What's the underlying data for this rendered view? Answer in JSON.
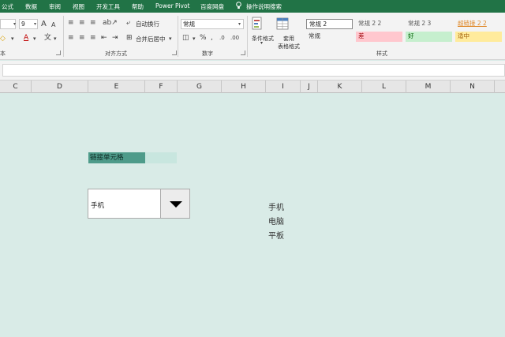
{
  "menu": {
    "items": [
      "公式",
      "数据",
      "审阅",
      "视图",
      "开发工具",
      "帮助",
      "Power Pivot",
      "百度网盘",
      "操作说明搜索"
    ]
  },
  "ribbon": {
    "font": {
      "size": "9",
      "grow_icon": "A",
      "shrink_icon": "A",
      "label": "本"
    },
    "alignment": {
      "wrap_text": "自动换行",
      "merge_center": "合并后居中",
      "label": "对齐方式"
    },
    "number": {
      "format": "常规",
      "label": "数字"
    },
    "styles": {
      "conditional_format": "条件格式",
      "table_format_line1": "套用",
      "table_format_line2": "表格格式",
      "label": "样式",
      "gallery": [
        [
          "常规 2",
          "常规 2 2",
          "常规 2 3",
          "超链接 2 2"
        ],
        [
          "常规",
          "差",
          "好",
          "适中"
        ]
      ]
    }
  },
  "columns": [
    "C",
    "D",
    "E",
    "F",
    "G",
    "H",
    "I",
    "J",
    "K",
    "L",
    "M",
    "N"
  ],
  "sheet": {
    "linked_cell": "链接单元格",
    "combo_value": "手机",
    "options": [
      "手机",
      "电脑",
      "平板"
    ]
  },
  "colors": {
    "accent": "#217346",
    "sheet_bg": "#d9ebe7",
    "linked_cell": "#4e9b8a",
    "bad_bg": "#ffc7ce",
    "good_bg": "#c6efce",
    "neutral_bg": "#ffeb9c"
  }
}
